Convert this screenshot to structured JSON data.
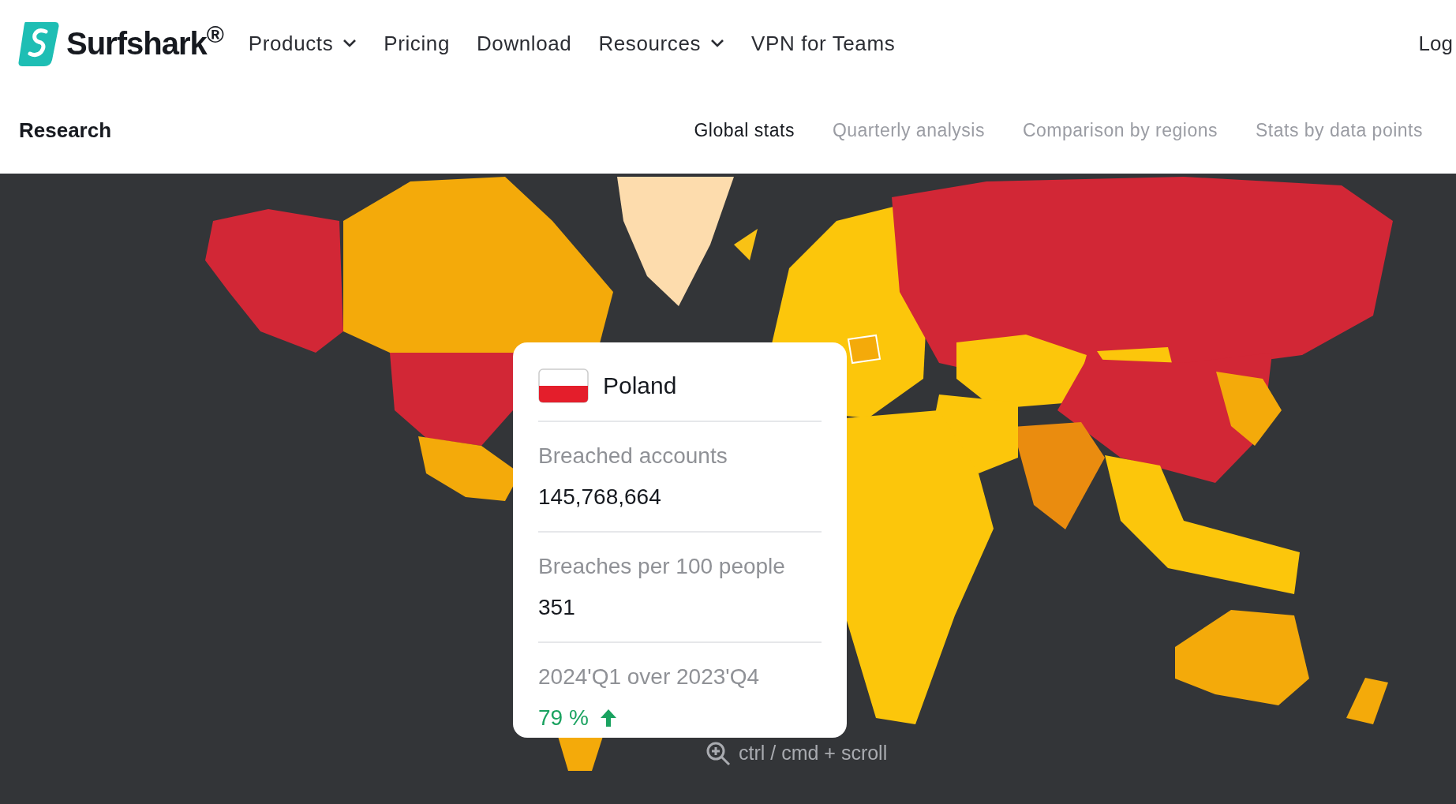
{
  "header": {
    "logo": "Surfshark$^{®}$",
    "nav": [
      {
        "label": "Products",
        "kind": "dropdown"
      },
      {
        "label": "Pricing",
        "kind": "link"
      },
      {
        "label": "Download",
        "kind": "link"
      },
      {
        "label": "Resources",
        "kind": "dropdown"
      },
      {
        "label": "VPN for Teams",
        "kind": "link"
      }
    ],
    "login": "Log"
  },
  "subnav": {
    "title": "Research",
    "tabs": [
      {
        "label": "Global stats",
        "selected": true
      },
      {
        "label": "Quarterly analysis",
        "selected": false
      },
      {
        "label": "Comparison by regions",
        "selected": false
      },
      {
        "label": "Stats by data points",
        "selected": false
      }
    ]
  },
  "tooltip": {
    "country": "Poland",
    "stats": [
      {
        "label": "Breached accounts",
        "value": "145,768,664"
      },
      {
        "label": "Breaches per 100 people",
        "value": "351"
      }
    ],
    "change": {
      "label": "2024'Q1 over 2023'Q4",
      "value": "79 %",
      "rising": true
    }
  },
  "zoom_hint": "ctrl / cmd + scroll"
}
